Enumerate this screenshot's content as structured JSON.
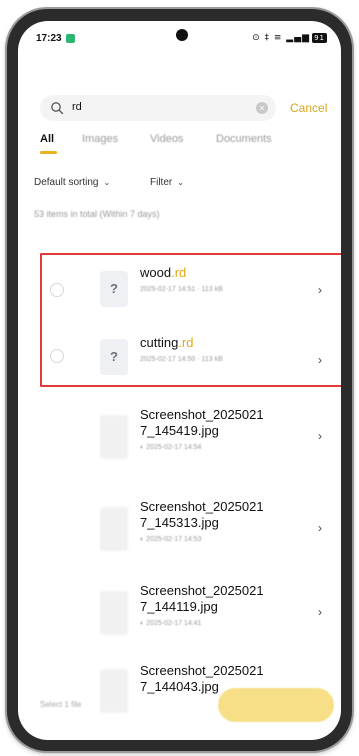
{
  "status": {
    "time": "17:23",
    "icons": "⊙ ‡ ≡ ▂▄▆",
    "battery": "91"
  },
  "search": {
    "value": "rd",
    "cancel_label": "Cancel"
  },
  "tabs": [
    {
      "label": "All"
    },
    {
      "label": "Images"
    },
    {
      "label": "Videos"
    },
    {
      "label": "Documents"
    }
  ],
  "filters": {
    "sort_label": "Default sorting",
    "filter_label": "Filter"
  },
  "summary": "53 items in total (Within 7 days)",
  "files": [
    {
      "name": "wood",
      "ext": ".rd",
      "meta": "2025-02-17 14:51 · 113 kB",
      "icon": "question-mark"
    },
    {
      "name": "cutting",
      "ext": ".rd",
      "meta": "2025-02-17 14:50 · 113 kB",
      "icon": "question-mark"
    },
    {
      "name": "Screenshot_2025021\n7_145419.jpg",
      "meta": "◐ 2025-02-17 14:54",
      "icon": "image-thumbnail"
    },
    {
      "name": "Screenshot_2025021\n7_145313.jpg",
      "meta": "◐ 2025-02-17 14:53",
      "icon": "image-thumbnail"
    },
    {
      "name": "Screenshot_2025021\n7_144119.jpg",
      "meta": "◐ 2025-02-17 14:41",
      "icon": "image-thumbnail"
    },
    {
      "name": "Screenshot_2025021\n7_144043.jpg",
      "meta": "",
      "icon": "image-thumbnail"
    }
  ],
  "bottom": {
    "selected_text": "Select 1 file"
  },
  "colors": {
    "accent": "#e0a816",
    "highlight": "#e03c3c"
  }
}
